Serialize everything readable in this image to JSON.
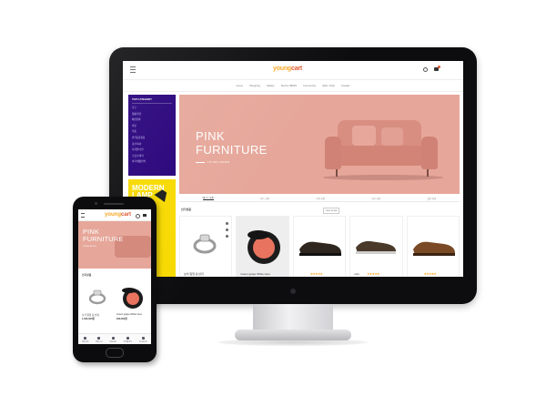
{
  "desktop": {
    "logo_a": "young",
    "logo_b": "cart",
    "nav": [
      "Home",
      "Shopping",
      "Gallery",
      "Sports NEWS",
      "Community",
      "Q&A / FAQ",
      "Contact"
    ],
    "sidebar_title": "TOP CATEGORY",
    "sidebar_items": [
      "가구",
      "생활/건강",
      "패션잡화",
      "의류",
      "식품",
      "반려동물용품",
      "출산/육아",
      "디지털/가전",
      "스포츠/레저",
      "여가/생활편의"
    ],
    "lamp_text": "MODERN LAMP",
    "banner_title": "PINK FURNITURE",
    "banner_sub": "LIVING ROOM",
    "tabs": [
      "베스트 상품",
      "히트 상품",
      "추천 상품",
      "최신 상품",
      "할인 상품"
    ],
    "section_title": "인기상품",
    "more_label": "VIEW MORE",
    "products": [
      {
        "name": "보석 원형 링 반지"
      },
      {
        "name": "Green grape White wine"
      },
      {
        "name": ""
      },
      {
        "name": "oxfo"
      },
      {
        "name": ""
      }
    ],
    "stars": "★★★★★",
    "colors": {
      "banner": "#e6a79a",
      "sidebar": "#26007a",
      "lamp": "#f7d900",
      "star": "#ff9800"
    }
  },
  "phone": {
    "logo_a": "young",
    "logo_b": "cart",
    "banner_title": "PINK FURNITURE",
    "banner_sub": "LIVING ROOM",
    "section_title": "인기상품",
    "products": [
      {
        "name": "보석 원형 링 반지",
        "price": "1,000,000원"
      },
      {
        "name": "Green grape White wine",
        "price": "200,000원"
      }
    ],
    "bottom_nav": [
      "카테고리",
      "장바구니",
      "주문조회",
      "마이페이지",
      "위시리스트"
    ]
  }
}
